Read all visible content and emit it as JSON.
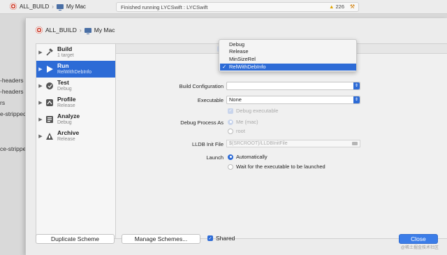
{
  "toolbar": {
    "scheme_name": "ALL_BUILD",
    "destination": "My Mac",
    "status_text": "Finished running LYCSwift : LYCSwift",
    "warning_count": "226",
    "warning_icon": "warning-triangle-icon",
    "build_icon": "hammer-icon"
  },
  "background_sidebar": {
    "lines": [
      "-headers",
      "-headers",
      "rs",
      "e-stripped",
      "ce-strippe"
    ]
  },
  "sheet": {
    "breadcrumb": {
      "scheme": "ALL_BUILD",
      "destination": "My Mac"
    },
    "actions": [
      {
        "name": "Build",
        "sub": "1 target",
        "icon": "hammer-icon",
        "selected": false
      },
      {
        "name": "Run",
        "sub": "RelWithDebInfo",
        "icon": "play-icon",
        "selected": true
      },
      {
        "name": "Test",
        "sub": "Debug",
        "icon": "wrench-icon",
        "selected": false
      },
      {
        "name": "Profile",
        "sub": "Release",
        "icon": "gauge-icon",
        "selected": false
      },
      {
        "name": "Analyze",
        "sub": "Debug",
        "icon": "analyze-icon",
        "selected": false
      },
      {
        "name": "Archive",
        "sub": "Release",
        "icon": "archive-icon",
        "selected": false
      }
    ],
    "settings": {
      "build_configuration_label": "Build Configuration",
      "executable_label": "Executable",
      "executable_value": "None",
      "debug_executable_label": "Debug executable",
      "debug_process_as_label": "Debug Process As",
      "debug_process_options": [
        "Me (mac)",
        "root"
      ],
      "lldb_init_label": "LLDB Init File",
      "lldb_init_placeholder": "$(SRCROOT)/LLDBInitFile",
      "launch_label": "Launch",
      "launch_options": [
        "Automatically",
        "Wait for the executable to be launched"
      ]
    },
    "configuration_menu": {
      "items": [
        "Debug",
        "Release",
        "MinSizeRel",
        "RelWithDebInfo"
      ],
      "selected": "RelWithDebInfo"
    },
    "footer": {
      "duplicate_label": "Duplicate Scheme",
      "manage_label": "Manage Schemes...",
      "shared_label": "Shared",
      "close_label": "Close"
    }
  },
  "watermark": "@稀土掘金技术社区",
  "colors": {
    "accent": "#2d6bd6",
    "warning": "#e0a400"
  }
}
